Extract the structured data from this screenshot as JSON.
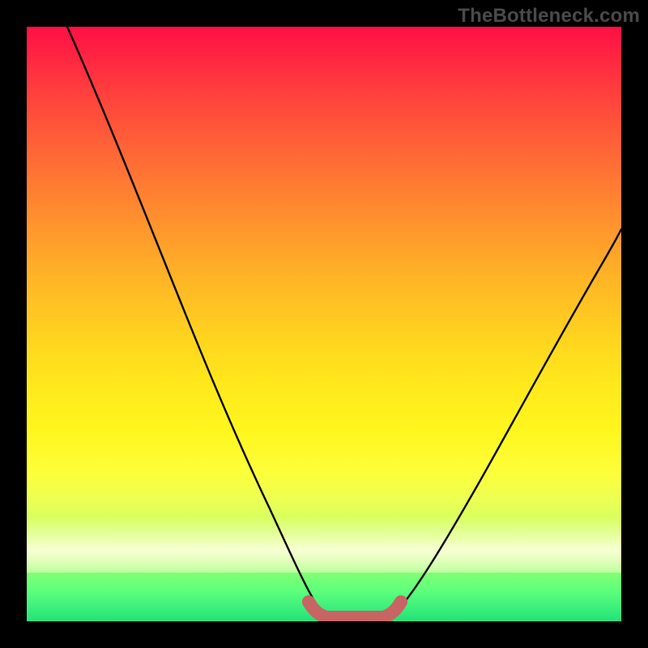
{
  "watermark": "TheBottleneck.com",
  "gradient": {
    "top": "#ff0f45",
    "mid": "#ffd31f",
    "bottom": "#22e27a"
  },
  "chart_data": {
    "type": "line",
    "title": "",
    "xlabel": "",
    "ylabel": "",
    "xlim": [
      0,
      100
    ],
    "ylim": [
      0,
      100
    ],
    "grid": false,
    "note": "Black curve shows bottleneck percentage vs. some x variable; dips to ~0 around x≈50. Salmon marker band indicates the optimal range. No axis ticks or labels are rendered in the image.",
    "series": [
      {
        "name": "bottleneck-curve",
        "color": "#000000",
        "x": [
          0,
          5,
          10,
          15,
          20,
          25,
          30,
          35,
          40,
          45,
          48,
          50,
          52,
          55,
          60,
          65,
          70,
          75,
          80,
          85,
          90,
          95,
          100
        ],
        "y": [
          100,
          91,
          82,
          73,
          64,
          55,
          46,
          36,
          26,
          14,
          6,
          2,
          1,
          2,
          8,
          16,
          24,
          32,
          40,
          47,
          54,
          61,
          67
        ]
      },
      {
        "name": "optimal-range-markers",
        "color": "#c86464",
        "x": [
          45,
          46,
          47,
          48,
          49,
          50,
          51,
          52,
          53,
          54,
          55,
          56,
          57,
          58
        ],
        "y": [
          4,
          3,
          2.5,
          2,
          1.7,
          1.5,
          1.4,
          1.4,
          1.5,
          1.7,
          2,
          2.5,
          3,
          4
        ]
      }
    ]
  }
}
